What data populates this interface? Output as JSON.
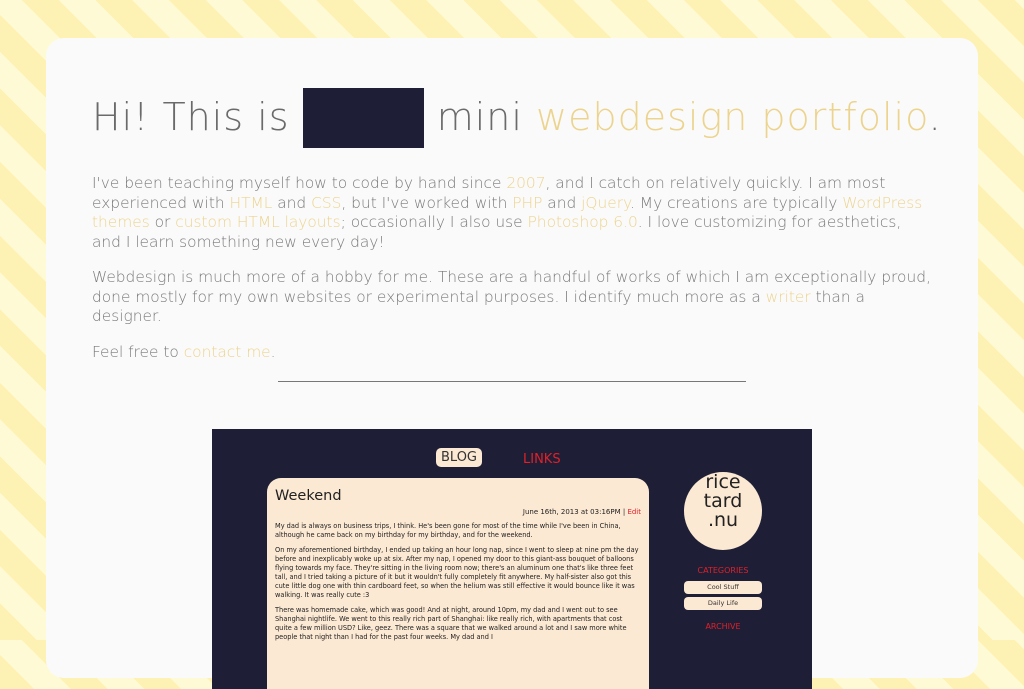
{
  "hero": {
    "greeting": "Hi! This is",
    "after_redacted": "mini",
    "accent": "webdesign portfolio",
    "period": "."
  },
  "intro": {
    "t1": "I've been teaching myself how to code by hand since ",
    "year": "2007",
    "t2": ", and I catch on relatively quickly. I am most experienced with ",
    "html": "HTML",
    "t3": " and ",
    "css": "CSS",
    "t4": ", but I've worked with ",
    "php": "PHP",
    "t5": " and ",
    "jquery": "jQuery",
    "t6": ". My creations are typically ",
    "wp": "WordPress themes",
    "t7": " or ",
    "custom": "custom HTML layouts",
    "t8": "; occasionally I also use ",
    "ps": "Photoshop 6.0",
    "t9": ". I love customizing for aesthetics, and I learn something new every day!"
  },
  "hobby": {
    "t1": "Webdesign is much more of a hobby for me. These are a handful of works of which I am exceptionally proud, done mostly for my own websites or experimental purposes. I identify much more as a ",
    "writer": "writer",
    "t2": " than a designer."
  },
  "contact": {
    "t1": "Feel free to ",
    "link": "contact me",
    "t2": "."
  },
  "preview": {
    "nav": {
      "blog": "BLOG",
      "links": "LINKS"
    },
    "post_title": "Weekend",
    "post_date": "June 16th, 2013 at 03:16PM |",
    "post_edit": "Edit",
    "paragraphs": [
      "My dad is always on business trips, I think. He's been gone for most of the time while I've been in China, although he came back on my birthday for my birthday, and for the weekend.",
      "On my aforementioned birthday, I ended up taking an hour long nap, since I went to sleep at nine pm the day before and inexplicably woke up at six. After my nap, I opened my door to this giant-ass bouquet of balloons flying towards my face. They're sitting in the living room now; there's an aluminum one that's like three feet tall, and I tried taking a picture of it but it wouldn't fully completely fit anywhere. My half-sister also got this cute little dog one with thin cardboard feet, so when the helium was still effective it would bounce like it was walking. It was really cute :3",
      "There was homemade cake, which was good! And at night, around 10pm, my dad and I went out to see Shanghai nightlife. We went to this really rich part of Shanghai: like really rich, with apartments that cost quite a few million USD? Like, geez. There was a square that we walked around a lot and I saw more white people that night than I had for the past four weeks. My dad and I"
    ],
    "logo": [
      "rice",
      "tard",
      ".nu"
    ],
    "categories_heading": "CATEGORIES",
    "categories": [
      "Cool Stuff",
      "Daily Life"
    ],
    "archive_heading": "ARCHIVE"
  }
}
